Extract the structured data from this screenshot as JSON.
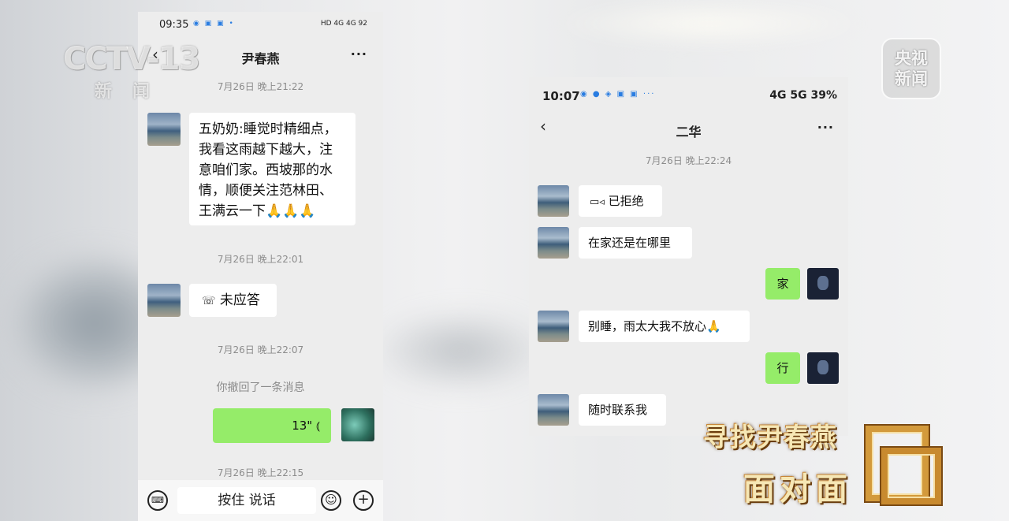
{
  "phone1": {
    "status_time": "09:35",
    "status_right": "HD 4G 4G 92",
    "contact_name": "尹春燕",
    "messages": [
      {
        "time": "7月26日 晚上21:22"
      },
      {
        "text_lines": [
          "五奶奶:睡觉时精细点，",
          "我看这雨越下越大，注",
          "意咱们家。西坡那的水",
          "情，顺便关注范林田、",
          "王满云一下🙏🙏🙏"
        ]
      },
      {
        "time": "7月26日 晚上22:01"
      },
      {
        "call_text": "未应答"
      },
      {
        "time": "7月26日 晚上22:07"
      },
      {
        "system": "你撤回了一条消息"
      },
      {
        "voice_duration": "13\""
      },
      {
        "time": "7月26日 晚上22:15"
      }
    ],
    "input_hold_label": "按住 说话"
  },
  "phone2": {
    "status_time": "10:07",
    "status_right": "4G 5G 39%",
    "contact_name": "二华",
    "time": "7月26日 晚上22:24",
    "video_call_text": "已拒绝",
    "msg_1": "在家还是在哪里",
    "reply_1": "家",
    "msg_2": "别睡，雨太大我不放心🙏",
    "reply_2": "行",
    "msg_3": "随时联系我"
  },
  "overlay": {
    "channel_logo": "CCTV-13",
    "channel_sub": "新闻",
    "corner_logo_line1": "央视",
    "corner_logo_line2": "新闻",
    "program_line1": "寻找尹春燕",
    "program_line2": "面对面"
  }
}
